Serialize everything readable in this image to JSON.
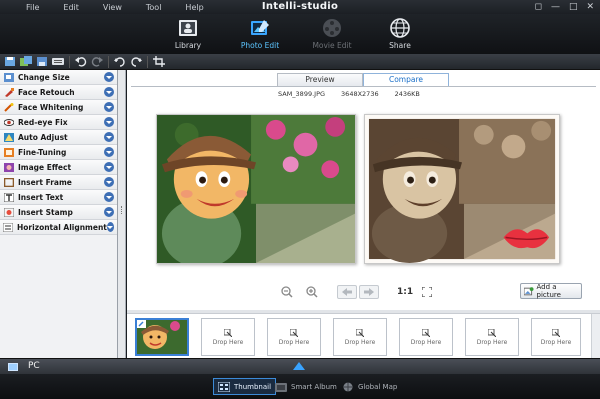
{
  "window": {
    "title": "Intelli-studio",
    "menu": [
      "File",
      "Edit",
      "View",
      "Tool",
      "Help"
    ],
    "controls": [
      "restore-icon",
      "minimize-icon",
      "maximize-icon",
      "close-icon"
    ]
  },
  "modes": [
    {
      "label": "Library",
      "icon": "library-icon",
      "state": "normal"
    },
    {
      "label": "Photo Edit",
      "icon": "photo-edit-icon",
      "state": "active"
    },
    {
      "label": "Movie Edit",
      "icon": "movie-edit-icon",
      "state": "disabled"
    },
    {
      "label": "Share",
      "icon": "share-globe-icon",
      "state": "normal"
    }
  ],
  "toolbar": {
    "icons": [
      "save-icon",
      "save-all-icon",
      "save-as-icon",
      "keyboard-icon",
      "undo-icon",
      "redo-icon",
      "rotate-left-icon",
      "rotate-right-icon",
      "crop-icon"
    ]
  },
  "edit_panel": {
    "items": [
      {
        "label": "Change Size",
        "icon": "resize-icon"
      },
      {
        "label": "Face Retouch",
        "icon": "brush-icon"
      },
      {
        "label": "Face Whitening",
        "icon": "wand-icon"
      },
      {
        "label": "Red-eye Fix",
        "icon": "eye-icon"
      },
      {
        "label": "Auto Adjust",
        "icon": "auto-adjust-icon"
      },
      {
        "label": "Fine-Tuning",
        "icon": "fine-tuning-icon"
      },
      {
        "label": "Image Effect",
        "icon": "image-effect-icon"
      },
      {
        "label": "Insert Frame",
        "icon": "frame-icon"
      },
      {
        "label": "Insert Text",
        "icon": "text-icon"
      },
      {
        "label": "Insert Stamp",
        "icon": "stamp-icon"
      },
      {
        "label": "Horizontal Alignment",
        "icon": "alignment-icon"
      }
    ]
  },
  "view": {
    "tabs": [
      {
        "label": "Preview",
        "active": false
      },
      {
        "label": "Compare",
        "active": true
      }
    ],
    "file": {
      "name": "SAM_3899.JPG",
      "dimensions": "3648X2736",
      "size": "2436KB"
    },
    "zoom_ratio": "1:1",
    "add_picture": "Add a picture"
  },
  "strip": {
    "drop_label": "Drop Here",
    "drop_count": 7
  },
  "source": {
    "label": "PC"
  },
  "views": [
    {
      "label": "Thumbnail",
      "icon": "thumbnail-icon",
      "active": true
    },
    {
      "label": "Smart Album",
      "icon": "smart-album-icon",
      "active": false
    },
    {
      "label": "Global Map",
      "icon": "globe-icon",
      "active": false
    }
  ],
  "colors": {
    "accent": "#3a8fdc",
    "active_mode": "#5cc5ff",
    "chevron": "#3e6fb5"
  }
}
